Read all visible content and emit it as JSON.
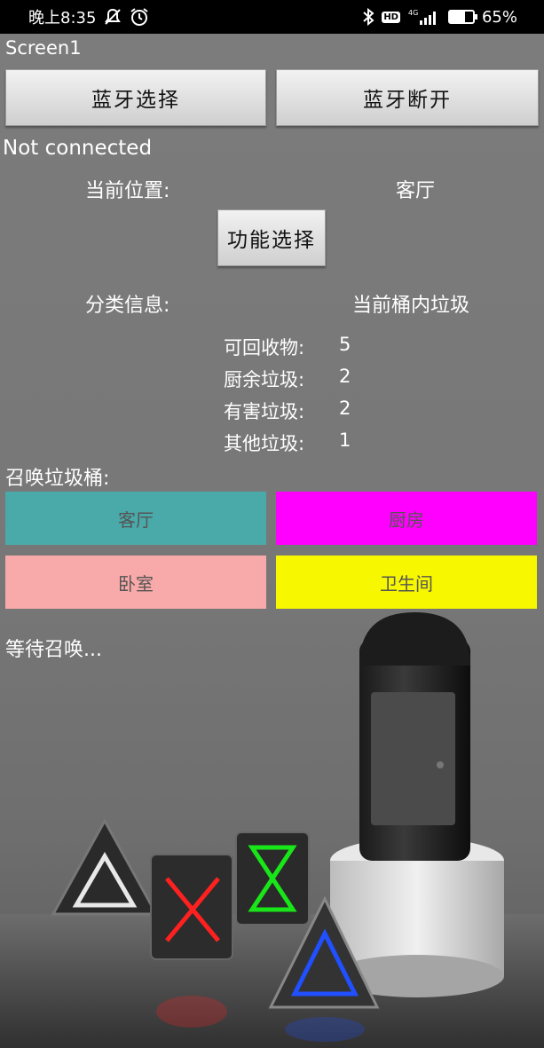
{
  "status_bar": {
    "time": "晚上8:35",
    "network": "4G",
    "battery": "65%",
    "battery_level": 0.65
  },
  "screen": {
    "title": "Screen1"
  },
  "bluetooth": {
    "select_label": "蓝牙选择",
    "disconnect_label": "蓝牙断开",
    "status": "Not connected"
  },
  "location": {
    "label": "当前位置:",
    "value": "客厅"
  },
  "function_button": {
    "label": "功能选择"
  },
  "classification": {
    "label": "分类信息:",
    "header": "当前桶内垃圾",
    "items": [
      {
        "name": "可回收物:",
        "count": "5"
      },
      {
        "name": "厨余垃圾:",
        "count": "2"
      },
      {
        "name": "有害垃圾:",
        "count": "2"
      },
      {
        "name": "其他垃圾:",
        "count": "1"
      }
    ]
  },
  "summon": {
    "label": "召唤垃圾桶:",
    "rooms": [
      {
        "label": "客厅",
        "color": "#4aa9a9"
      },
      {
        "label": "厨房",
        "color": "#ff00ff"
      },
      {
        "label": "卧室",
        "color": "#f8a9a9"
      },
      {
        "label": "卫生间",
        "color": "#f7f700"
      }
    ],
    "status": "等待召唤..."
  },
  "colors": {
    "status_bar_bg": "#000000",
    "background": "#777777",
    "button_bg": "#e0e0e0"
  }
}
